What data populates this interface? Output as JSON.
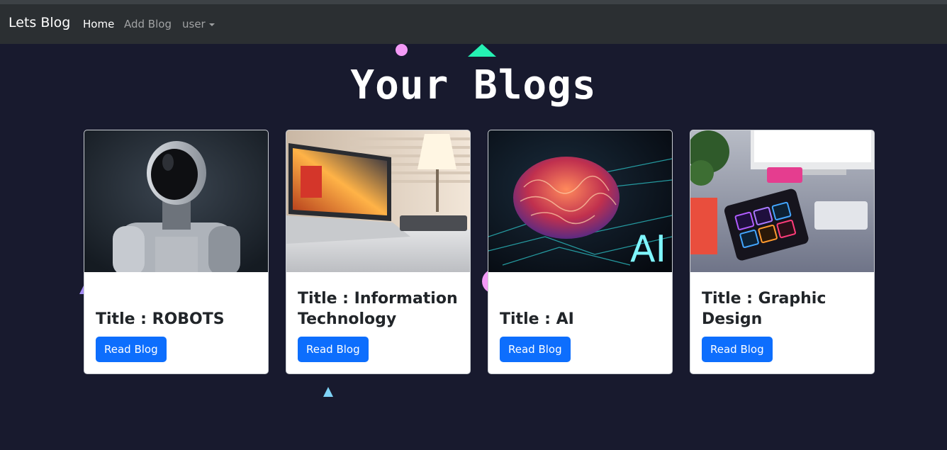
{
  "navbar": {
    "brand": "Lets Blog",
    "links": [
      {
        "label": "Home",
        "active": true
      },
      {
        "label": "Add Blog",
        "active": false
      },
      {
        "label": "user",
        "active": false,
        "dropdown": true
      }
    ]
  },
  "page": {
    "heading": "Your Blogs"
  },
  "cards": [
    {
      "title": "Title : ROBOTS",
      "button": "Read Blog",
      "image": "robot-image"
    },
    {
      "title": "Title : Information Technology",
      "button": "Read Blog",
      "image": "laptop-desk-image"
    },
    {
      "title": "Title : AI",
      "button": "Read Blog",
      "image": "ai-brain-image"
    },
    {
      "title": "Title : Graphic Design",
      "button": "Read Blog",
      "image": "design-workspace-image"
    }
  ],
  "colors": {
    "background": "#181a2e",
    "navbar": "#2b2f32",
    "primary_button": "#0d6efd",
    "accent_pink": "#f39af6",
    "accent_green": "#25f1b3"
  }
}
